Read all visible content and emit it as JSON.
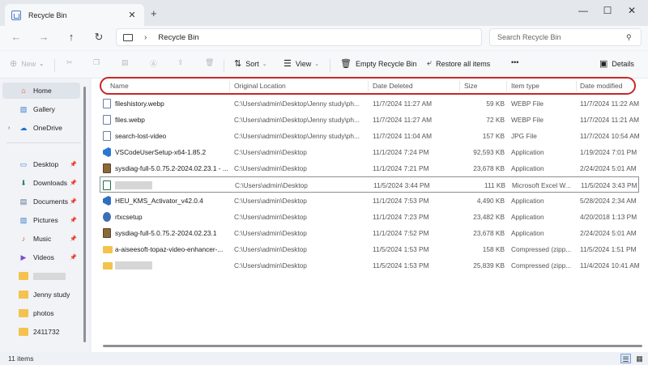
{
  "tab": {
    "title": "Recycle Bin",
    "close": "✕",
    "new": "+"
  },
  "window": {
    "minimize": "—",
    "maximize": "☐",
    "close": "✕"
  },
  "nav": {
    "back": "←",
    "forward": "→",
    "up": "↑",
    "refresh": "↻"
  },
  "address": {
    "path": "Recycle Bin",
    "separator": "›"
  },
  "search": {
    "placeholder": "Search Recycle Bin",
    "icon": "⚲"
  },
  "toolbar": {
    "new_label": "New",
    "sort_label": "Sort",
    "view_label": "View",
    "empty_label": "Empty Recycle Bin",
    "restore_label": "Restore all items",
    "more_label": "•••",
    "details_label": "Details"
  },
  "sidebar": {
    "items": [
      {
        "label": "Home",
        "icon": "home-icon"
      },
      {
        "label": "Gallery",
        "icon": "gallery-icon"
      },
      {
        "label": "OneDrive",
        "icon": "cloud-icon"
      },
      {
        "label": "Desktop",
        "icon": "desktop-icon"
      },
      {
        "label": "Downloads",
        "icon": "download-icon"
      },
      {
        "label": "Documents",
        "icon": "documents-icon"
      },
      {
        "label": "Pictures",
        "icon": "pictures-icon"
      },
      {
        "label": "Music",
        "icon": "music-icon"
      },
      {
        "label": "Videos",
        "icon": "videos-icon"
      },
      {
        "label": "",
        "icon": "folder-icon"
      },
      {
        "label": "Jenny study",
        "icon": "folder-icon"
      },
      {
        "label": "photos",
        "icon": "folder-icon"
      },
      {
        "label": "2411732",
        "icon": "folder-icon"
      }
    ]
  },
  "columns": {
    "name": "Name",
    "location": "Original Location",
    "deleted": "Date Deleted",
    "size": "Size",
    "type": "Item type",
    "modified": "Date modified"
  },
  "rows": [
    {
      "name": "fileshistory.webp",
      "location": "C:\\Users\\admin\\Desktop\\Jenny study\\ph...",
      "deleted": "11/7/2024 11:27 AM",
      "size": "59 KB",
      "type": "WEBP File",
      "modified": "11/7/2024 11:22 AM",
      "icon": "doc"
    },
    {
      "name": "files.webp",
      "location": "C:\\Users\\admin\\Desktop\\Jenny study\\ph...",
      "deleted": "11/7/2024 11:27 AM",
      "size": "72 KB",
      "type": "WEBP File",
      "modified": "11/7/2024 11:21 AM",
      "icon": "doc"
    },
    {
      "name": "search-lost-video",
      "location": "C:\\Users\\admin\\Desktop\\Jenny study\\ph...",
      "deleted": "11/7/2024 11:04 AM",
      "size": "157 KB",
      "type": "JPG File",
      "modified": "11/7/2024 10:54 AM",
      "icon": "doc"
    },
    {
      "name": "VSCodeUserSetup-x64-1.85.2",
      "location": "C:\\Users\\admin\\Desktop",
      "deleted": "11/1/2024 7:24 PM",
      "size": "92,593 KB",
      "type": "Application",
      "modified": "1/19/2024 7:01 PM",
      "icon": "vsc"
    },
    {
      "name": "sysdiag-full-5.0.75.2-2024.02.23.1 - ...",
      "location": "C:\\Users\\admin\\Desktop",
      "deleted": "11/1/2024 7:21 PM",
      "size": "23,678 KB",
      "type": "Application",
      "modified": "2/24/2024 5:01 AM",
      "icon": "app"
    },
    {
      "name": "",
      "location": "C:\\Users\\admin\\Desktop",
      "deleted": "11/5/2024 3:44 PM",
      "size": "111 KB",
      "type": "Microsoft Excel W...",
      "modified": "11/5/2024 3:43 PM",
      "icon": "xls",
      "focus": true
    },
    {
      "name": "HEU_KMS_Activator_v42.0.4",
      "location": "C:\\Users\\admin\\Desktop",
      "deleted": "11/1/2024 7:53 PM",
      "size": "4,490 KB",
      "type": "Application",
      "modified": "5/28/2024 2:34 AM",
      "icon": "vsc"
    },
    {
      "name": "rtxcsetup",
      "location": "C:\\Users\\admin\\Desktop",
      "deleted": "11/1/2024 7:23 PM",
      "size": "23,482 KB",
      "type": "Application",
      "modified": "4/20/2018 1:13 PM",
      "icon": "rtx"
    },
    {
      "name": "sysdiag-full-5.0.75.2-2024.02.23.1",
      "location": "C:\\Users\\admin\\Desktop",
      "deleted": "11/1/2024 7:52 PM",
      "size": "23,678 KB",
      "type": "Application",
      "modified": "2/24/2024 5:01 AM",
      "icon": "app"
    },
    {
      "name": "a-aiseesoft-topaz-video-enhancer-...",
      "location": "C:\\Users\\admin\\Desktop",
      "deleted": "11/5/2024 1:53 PM",
      "size": "158 KB",
      "type": "Compressed (zipp...",
      "modified": "11/5/2024 1:51 PM",
      "icon": "folder"
    },
    {
      "name": "",
      "location": "C:\\Users\\admin\\Desktop",
      "deleted": "11/5/2024 1:53 PM",
      "size": "25,839 KB",
      "type": "Compressed (zipp...",
      "modified": "11/4/2024 10:41 AM",
      "icon": "folder"
    }
  ],
  "status": {
    "count": "11 items"
  },
  "colors": {
    "highlight": "#c62828",
    "accent": "#2b78d4"
  }
}
